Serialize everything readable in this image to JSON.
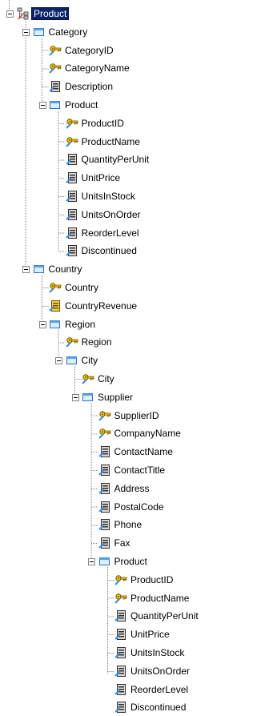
{
  "tree": {
    "selected_node": "Product",
    "nodes": [
      {
        "label": "Product",
        "type": "root",
        "level": 0,
        "expanded": true
      },
      {
        "label": "Category",
        "type": "level",
        "level": 1,
        "expanded": true
      },
      {
        "label": "CategoryID",
        "type": "key",
        "level": 2
      },
      {
        "label": "CategoryName",
        "type": "key",
        "level": 2
      },
      {
        "label": "Description",
        "type": "attribute",
        "level": 2
      },
      {
        "label": "Product",
        "type": "level",
        "level": 2,
        "expanded": true
      },
      {
        "label": "ProductID",
        "type": "key",
        "level": 3
      },
      {
        "label": "ProductName",
        "type": "key",
        "level": 3
      },
      {
        "label": "QuantityPerUnit",
        "type": "attribute",
        "level": 3
      },
      {
        "label": "UnitPrice",
        "type": "attribute",
        "level": 3
      },
      {
        "label": "UnitsInStock",
        "type": "attribute",
        "level": 3
      },
      {
        "label": "UnitsOnOrder",
        "type": "attribute",
        "level": 3
      },
      {
        "label": "ReorderLevel",
        "type": "attribute",
        "level": 3
      },
      {
        "label": "Discontinued",
        "type": "attribute",
        "level": 3
      },
      {
        "label": "Country",
        "type": "level",
        "level": 1,
        "expanded": true
      },
      {
        "label": "Country",
        "type": "key",
        "level": 2
      },
      {
        "label": "CountryRevenue",
        "type": "measure",
        "level": 2
      },
      {
        "label": "Region",
        "type": "level",
        "level": 2,
        "expanded": true
      },
      {
        "label": "Region",
        "type": "key",
        "level": 3
      },
      {
        "label": "City",
        "type": "level",
        "level": 3,
        "expanded": true
      },
      {
        "label": "City",
        "type": "key",
        "level": 4
      },
      {
        "label": "Supplier",
        "type": "level",
        "level": 4,
        "expanded": true
      },
      {
        "label": "SupplierID",
        "type": "key",
        "level": 5
      },
      {
        "label": "CompanyName",
        "type": "key",
        "level": 5
      },
      {
        "label": "ContactName",
        "type": "attribute",
        "level": 5
      },
      {
        "label": "ContactTitle",
        "type": "attribute",
        "level": 5
      },
      {
        "label": "Address",
        "type": "attribute",
        "level": 5
      },
      {
        "label": "PostalCode",
        "type": "attribute",
        "level": 5
      },
      {
        "label": "Phone",
        "type": "attribute",
        "level": 5
      },
      {
        "label": "Fax",
        "type": "attribute",
        "level": 5
      },
      {
        "label": "Product",
        "type": "level",
        "level": 5,
        "expanded": true
      },
      {
        "label": "ProductID",
        "type": "key",
        "level": 6
      },
      {
        "label": "ProductName",
        "type": "key",
        "level": 6
      },
      {
        "label": "QuantityPerUnit",
        "type": "attribute",
        "level": 6
      },
      {
        "label": "UnitPrice",
        "type": "attribute",
        "level": 6
      },
      {
        "label": "UnitsInStock",
        "type": "attribute",
        "level": 6
      },
      {
        "label": "UnitsOnOrder",
        "type": "attribute",
        "level": 6
      },
      {
        "label": "ReorderLevel",
        "type": "attribute",
        "level": 6
      },
      {
        "label": "Discontinued",
        "type": "attribute",
        "level": 6
      }
    ]
  },
  "colors": {
    "selection_bg": "#0a246a",
    "connector_line": "#808080",
    "key_icon": "#c8a000",
    "level_icon": "#3a8ee6",
    "attribute_icon": "#404040",
    "measure_icon": "#d4a800"
  },
  "icons": {
    "root": "hierarchy-icon",
    "level": "level-icon",
    "key": "key-icon",
    "attribute": "attribute-icon",
    "measure": "measure-icon"
  }
}
